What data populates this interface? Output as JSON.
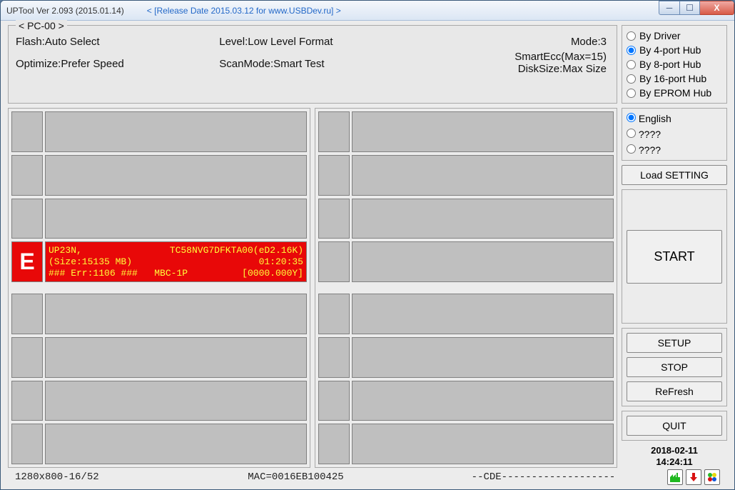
{
  "title": "UPTool Ver 2.093 (2015.01.14)",
  "release": "< [Release Date 2015.03.12 for www.USBDev.ru] >",
  "info": {
    "pc": "< PC-00 >",
    "flash_label": "Flash:",
    "flash": "Auto Select",
    "level_label": "Level:",
    "level": "Low Level Format",
    "mode_label": "Mode:",
    "mode": "3",
    "optimize_label": "Optimize:",
    "optimize": "Prefer Speed",
    "scanmode_label": "ScanMode:",
    "scanmode": "Smart Test",
    "smartecc_label": "SmartEcc(Max=15)",
    "disksize_label": "DiskSize:",
    "disksize": "Max Size"
  },
  "hub": {
    "options": [
      "By Driver",
      "By 4-port Hub",
      "By 8-port Hub",
      "By 16-port Hub",
      "By EPROM Hub"
    ],
    "selected": 1
  },
  "lang": {
    "options": [
      "English",
      "????",
      "????"
    ],
    "selected": 0
  },
  "buttons": {
    "load": "Load SETTING",
    "start": "START",
    "setup": "SETUP",
    "stop": "STOP",
    "refresh": "ReFresh",
    "quit": "QUIT"
  },
  "error_slot": {
    "handle": "E",
    "l1a": "UP23N,",
    "l1b": "TC58NVG7DFKTA00(eD2.16K)",
    "l2a": "(Size:15135 MB)",
    "l2b": "01:20:35",
    "l3a": "### Err:1106 ###   MBC-1P",
    "l3b": "[0000.000Y]"
  },
  "datetime": {
    "date": "2018-02-11",
    "time": "14:24:11"
  },
  "status": {
    "left": "1280x800-16/52",
    "mid": "MAC=0016EB100425",
    "mid2": "--CDE-------------------"
  }
}
